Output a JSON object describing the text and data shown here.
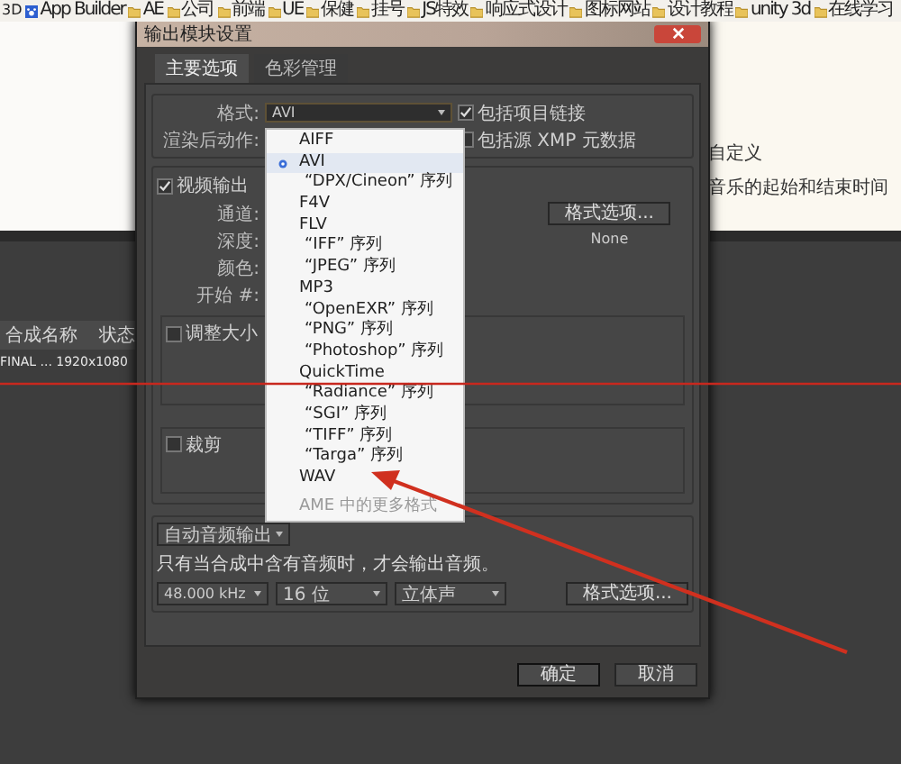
{
  "bookmarks": [
    {
      "label": "3D",
      "kind": "plain"
    },
    {
      "label": "App Builder",
      "kind": "app"
    },
    {
      "label": "AE",
      "kind": "folder"
    },
    {
      "label": "公司",
      "kind": "folder"
    },
    {
      "label": "前端",
      "kind": "folder"
    },
    {
      "label": "UE",
      "kind": "folder"
    },
    {
      "label": "保健",
      "kind": "folder"
    },
    {
      "label": "挂号",
      "kind": "folder"
    },
    {
      "label": "JS特效",
      "kind": "folder"
    },
    {
      "label": "响应式设计",
      "kind": "folder"
    },
    {
      "label": "图标网站",
      "kind": "folder"
    },
    {
      "label": "设计教程",
      "kind": "folder"
    },
    {
      "label": "unity 3d",
      "kind": "folder"
    },
    {
      "label": "在线学习",
      "kind": "folder"
    }
  ],
  "web_page": {
    "lines": [
      "自定义",
      "音乐的起始和结束时间"
    ]
  },
  "render_queue": {
    "columns": [
      "合成名称",
      "状态"
    ],
    "row": "FINAL ... 1920x1080"
  },
  "dialog": {
    "title": "输出模块设置",
    "tabs": [
      {
        "label": "主要选项",
        "selected": true
      },
      {
        "label": "色彩管理",
        "selected": false
      }
    ],
    "format_label": "格式:",
    "format_value": "AVI",
    "post_render_label": "渲染后动作:",
    "options": [
      {
        "label": "包括项目链接",
        "checked": true
      },
      {
        "label": "包括源 XMP 元数据",
        "checked": false
      }
    ],
    "video": {
      "label": "视频输出",
      "checked": true,
      "fields": [
        "通道:",
        "深度:",
        "颜色:",
        "开始 #:"
      ],
      "format_options_button": "格式选项...",
      "codec": "None",
      "resize": {
        "label": "调整大小",
        "checked": false
      },
      "crop": {
        "label": "裁剪",
        "checked": false
      }
    },
    "audio": {
      "mode": "自动音频输出",
      "note": "只有当合成中含有音频时，才会输出音频。",
      "selects": [
        "48.000 kHz",
        "16 位",
        "立体声"
      ],
      "format_options_button": "格式选项..."
    },
    "buttons": [
      "确定",
      "取消"
    ]
  },
  "format_menu": [
    {
      "label": "AIFF",
      "selected": false,
      "disabled": false,
      "kind": "format"
    },
    {
      "label": "AVI",
      "selected": true,
      "disabled": false,
      "kind": "format"
    },
    {
      "label": "“DPX/Cineon” 序列",
      "selected": false,
      "disabled": false,
      "kind": "sequence"
    },
    {
      "label": "F4V",
      "selected": false,
      "disabled": false,
      "kind": "format"
    },
    {
      "label": "FLV",
      "selected": false,
      "disabled": false,
      "kind": "format"
    },
    {
      "label": "“IFF” 序列",
      "selected": false,
      "disabled": false,
      "kind": "sequence"
    },
    {
      "label": "“JPEG” 序列",
      "selected": false,
      "disabled": false,
      "kind": "sequence"
    },
    {
      "label": "MP3",
      "selected": false,
      "disabled": false,
      "kind": "format"
    },
    {
      "label": "“OpenEXR” 序列",
      "selected": false,
      "disabled": false,
      "kind": "sequence"
    },
    {
      "label": "“PNG” 序列",
      "selected": false,
      "disabled": false,
      "kind": "sequence"
    },
    {
      "label": "“Photoshop” 序列",
      "selected": false,
      "disabled": false,
      "kind": "sequence"
    },
    {
      "label": "QuickTime",
      "selected": false,
      "disabled": false,
      "kind": "format"
    },
    {
      "label": "“Radiance” 序列",
      "selected": false,
      "disabled": false,
      "kind": "sequence"
    },
    {
      "label": "“SGI” 序列",
      "selected": false,
      "disabled": false,
      "kind": "sequence"
    },
    {
      "label": "“TIFF” 序列",
      "selected": false,
      "disabled": false,
      "kind": "sequence"
    },
    {
      "label": "“Targa” 序列",
      "selected": false,
      "disabled": false,
      "kind": "sequence"
    },
    {
      "label": "WAV",
      "selected": false,
      "disabled": false,
      "kind": "format"
    },
    {
      "label": "AME 中的更多格式",
      "selected": false,
      "disabled": true,
      "kind": "more"
    }
  ]
}
